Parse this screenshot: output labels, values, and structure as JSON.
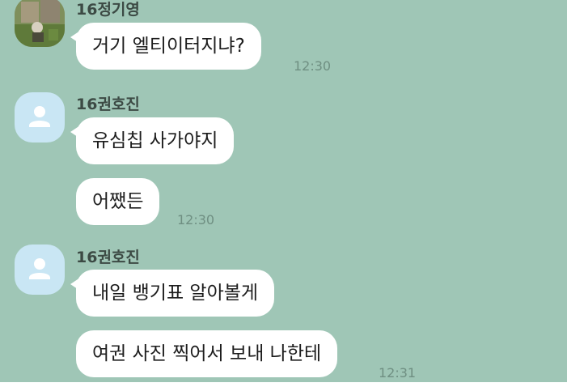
{
  "messages": [
    {
      "sender": "16정기영",
      "avatar": "photo-avatar",
      "bubbles": [
        "거기 엘티이터지냐?"
      ],
      "time": "12:30"
    },
    {
      "sender": "16권호진",
      "avatar": "default-person-icon",
      "bubbles": [
        "유심칩 사가야지",
        "어쨌든"
      ],
      "time": "12:30"
    },
    {
      "sender": "16권호진",
      "avatar": "default-person-icon",
      "bubbles": [
        "내일 뱅기표 알아볼게",
        "여권 사진 찍어서 보내 나한테"
      ],
      "time": "12:31"
    }
  ],
  "colors": {
    "chat_background": "#9fc6b6",
    "bubble": "#ffffff",
    "default_avatar": "#c9e6f4",
    "timestamp": "#6f8f82"
  }
}
